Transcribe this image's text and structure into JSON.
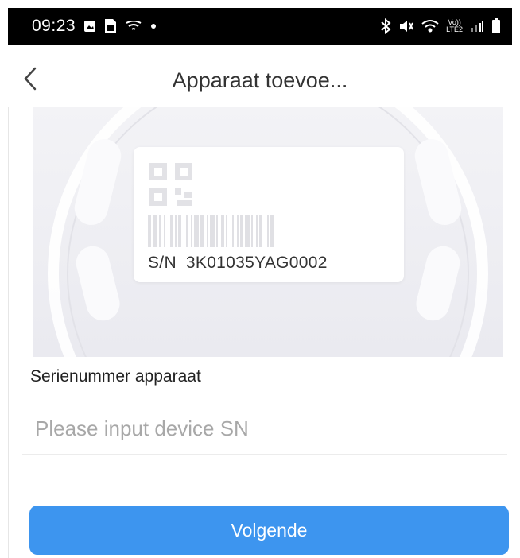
{
  "status_bar": {
    "time": "09:23",
    "left_icons": [
      "screenshot-icon",
      "sim-card-icon",
      "cast-icon",
      "dot-icon"
    ],
    "right_icons": [
      "bluetooth-icon",
      "mute-vibrate-icon",
      "wifi-icon",
      "volte-lte2-icon",
      "signal-icon",
      "battery-icon"
    ],
    "volte_label": "Vo))",
    "lte_label": "LTE2"
  },
  "header": {
    "back_icon": "chevron-left-icon",
    "title": "Apparaat toevoe..."
  },
  "sn_card": {
    "prefix": "S/N",
    "serial": "3K01035YAG0002"
  },
  "form": {
    "label": "Serienummer apparaat",
    "input_value": "",
    "input_placeholder": "Please input device SN"
  },
  "actions": {
    "next_label": "Volgende"
  },
  "colors": {
    "accent": "#3d95ef",
    "status_bar": "#000000",
    "hero_bg": "#eeeef2"
  }
}
